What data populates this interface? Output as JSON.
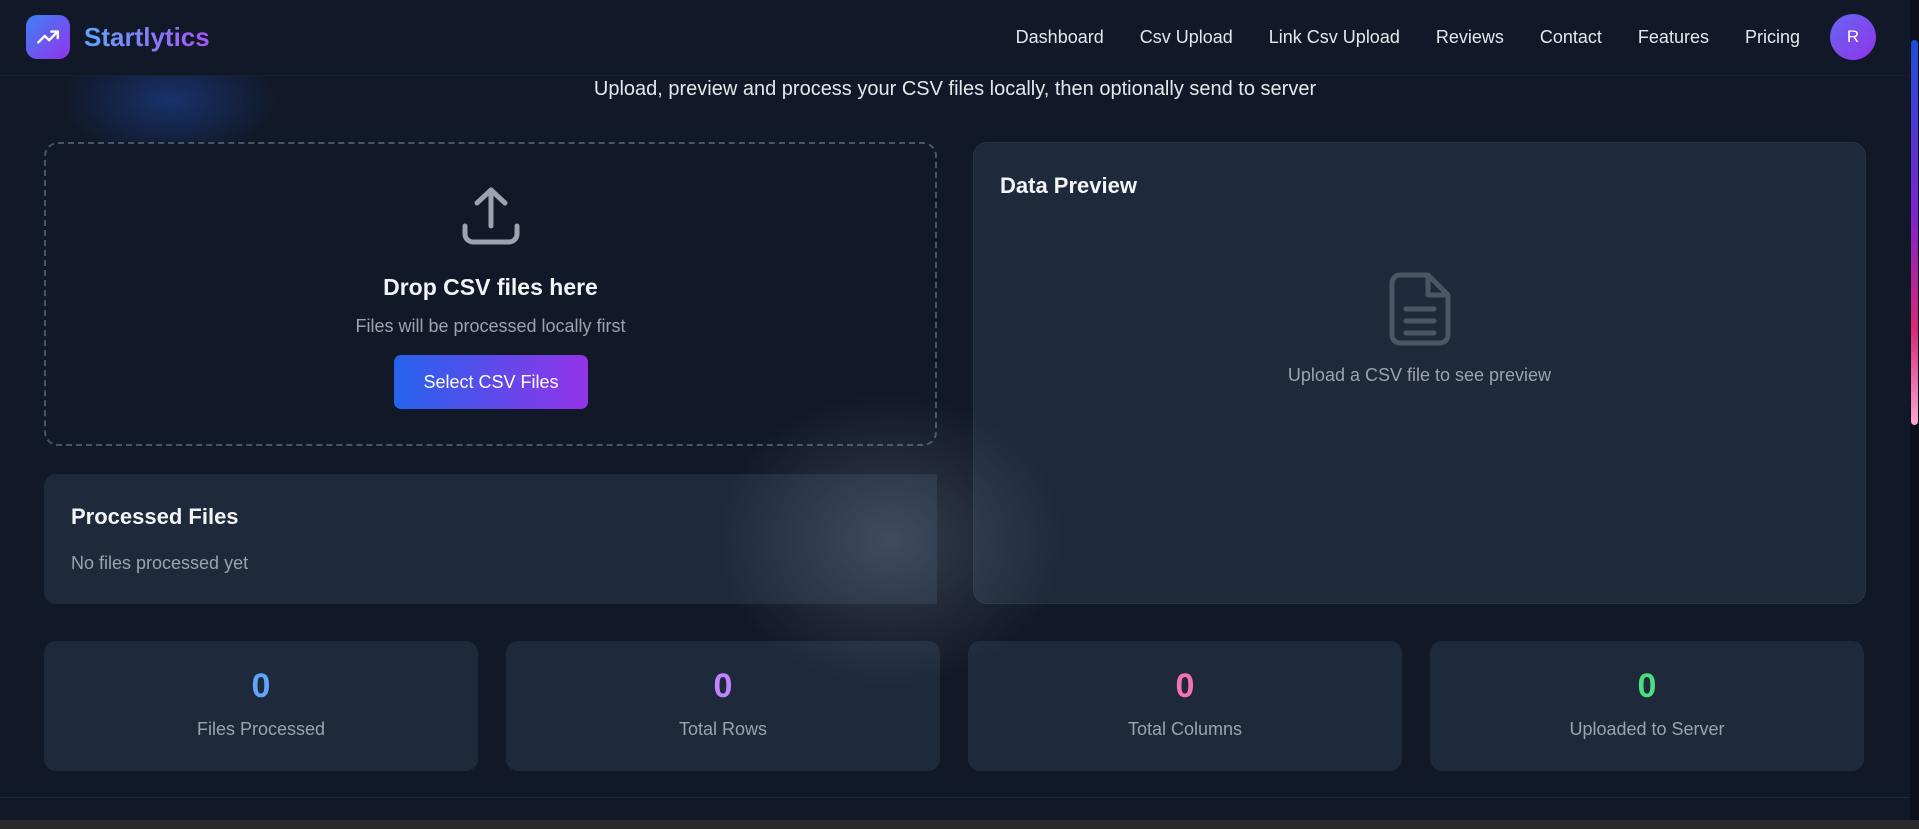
{
  "brand": {
    "name": "Startlytics",
    "logo_icon": "trending-up-icon"
  },
  "nav": {
    "items": [
      "Dashboard",
      "Csv Upload",
      "Link Csv Upload",
      "Reviews",
      "Contact",
      "Features",
      "Pricing"
    ],
    "avatar_initial": "R"
  },
  "page": {
    "subtitle": "Upload, preview and process your CSV files locally, then optionally send to server"
  },
  "dropzone": {
    "icon": "upload-icon",
    "title": "Drop CSV files here",
    "subtitle": "Files will be processed locally first",
    "button_label": "Select CSV Files"
  },
  "processed": {
    "title": "Processed Files",
    "empty_text": "No files processed yet"
  },
  "preview": {
    "title": "Data Preview",
    "icon": "file-text-icon",
    "empty_text": "Upload a CSV file to see preview"
  },
  "stats": [
    {
      "value": "0",
      "label": "Files Processed",
      "color": "#60a5fa"
    },
    {
      "value": "0",
      "label": "Total Rows",
      "color": "#c084fc"
    },
    {
      "value": "0",
      "label": "Total Columns",
      "color": "#f472b6"
    },
    {
      "value": "0",
      "label": "Uploaded to Server",
      "color": "#4ade80"
    }
  ],
  "colors": {
    "background": "#111827",
    "card": "#1e293b",
    "accent_start": "#2563eb",
    "accent_end": "#9333ea"
  }
}
